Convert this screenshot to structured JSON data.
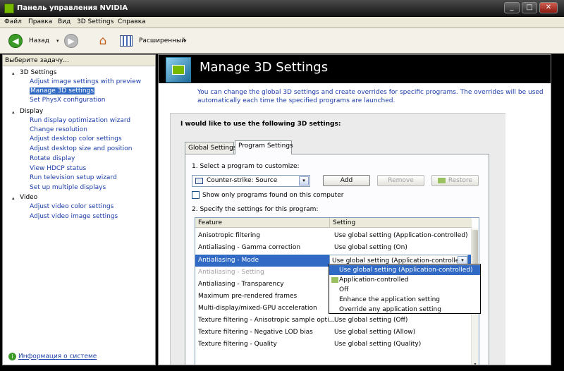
{
  "window": {
    "title": "Панель управления NVIDIA",
    "min_glyph": "_",
    "max_glyph": "□",
    "close_glyph": "✕"
  },
  "menu": [
    "Файл",
    "Правка",
    "Вид",
    "3D Settings",
    "Справка"
  ],
  "toolbar": {
    "back_label": "Назад",
    "view_label": "Расширенный",
    "dropdown_glyph": "▾",
    "back_glyph": "◀",
    "forward_glyph": "▶",
    "home_glyph": "⌂"
  },
  "sidebar": {
    "header": "Выберите задачу...",
    "groups": [
      {
        "label": "3D Settings",
        "items": [
          "Adjust image settings with preview",
          "Manage 3D settings",
          "Set PhysX configuration"
        ]
      },
      {
        "label": "Display",
        "items": [
          "Run display optimization wizard",
          "Change resolution",
          "Adjust desktop color settings",
          "Adjust desktop size and position",
          "Rotate display",
          "View HDCP status",
          "Run television setup wizard",
          "Set up multiple displays"
        ]
      },
      {
        "label": "Video",
        "items": [
          "Adjust video color settings",
          "Adjust video image settings"
        ]
      }
    ],
    "toggle_glyph": "▴",
    "system_info": "Информация о системе",
    "info_glyph": "i"
  },
  "main": {
    "title": "Manage 3D Settings",
    "description": "You can change the global 3D settings and create overrides for specific programs. The overrides will be used automatically each time the specified programs are launched.",
    "panel_heading": "I would like to use the following 3D settings:",
    "tabs": [
      "Global Settings",
      "Program Settings"
    ],
    "step1": "1. Select a program to customize:",
    "program": "Counter-strike: Source",
    "add_button": "Add",
    "remove_button": "Remove",
    "restore_button": "Restore",
    "show_only": "Show only programs found on this computer",
    "step2": "2. Specify the settings for this program:",
    "table": {
      "headers": [
        "Feature",
        "Setting"
      ],
      "rows": [
        {
          "feature": "Anisotropic filtering",
          "setting": "Use global setting (Application-controlled)"
        },
        {
          "feature": "Antialiasing - Gamma correction",
          "setting": "Use global setting (On)"
        },
        {
          "feature": "Antialiasing - Mode",
          "setting": "Use global setting (Application-controlled)"
        },
        {
          "feature": "Antialiasing - Setting",
          "setting": ""
        },
        {
          "feature": "Antialiasing - Transparency",
          "setting": ""
        },
        {
          "feature": "Maximum pre-rendered frames",
          "setting": ""
        },
        {
          "feature": "Multi-display/mixed-GPU acceleration",
          "setting": ""
        },
        {
          "feature": "Texture filtering - Anisotropic sample opti...",
          "setting": "Use global setting (Off)"
        },
        {
          "feature": "Texture filtering - Negative LOD bias",
          "setting": "Use global setting (Allow)"
        },
        {
          "feature": "Texture filtering - Quality",
          "setting": "Use global setting (Quality)"
        }
      ]
    },
    "dropdown_options": [
      "Use global setting (Application-controlled)",
      "Application-controlled",
      "Off",
      "Enhance the application setting",
      "Override any application setting"
    ]
  },
  "colors": {
    "accent": "#76b900",
    "selection": "#316ac5",
    "link": "#1a3ca8"
  }
}
